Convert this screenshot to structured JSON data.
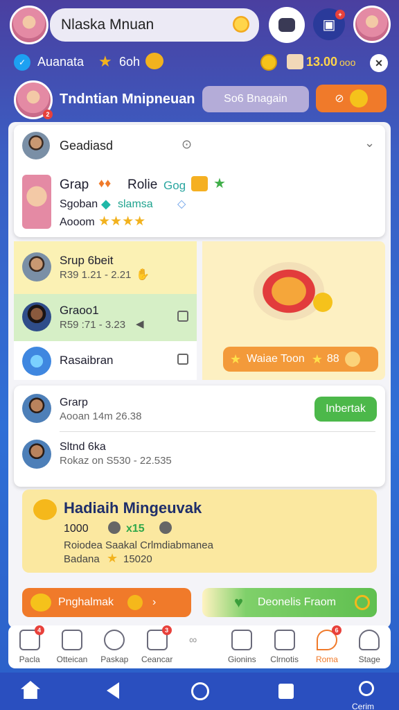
{
  "header": {
    "name_field": "Nlaska Mnuan",
    "sub_left": "Auanata",
    "sub_mid": "6oh",
    "coins": "13.00",
    "coins_suffix": "ooo"
  },
  "group_bar": {
    "title": "Tndntian Mnipneuan",
    "button": "So6 Bnagain"
  },
  "top_card": {
    "name": "Geadiasd",
    "line1": "Grap",
    "line1b": "Rolie",
    "line1c": "Gog",
    "line2": "Sgoban",
    "line2b": "slamsa",
    "line3": "Aooom"
  },
  "list_left": [
    {
      "title": "Srup 6beit",
      "sub": "R39 1.21 - 2.21"
    },
    {
      "title": "Graoo1",
      "sub": "R59 :71 - 3.23"
    },
    {
      "title": "Rasaibran",
      "sub": ""
    }
  ],
  "promo_right": {
    "button": "Waiae Toon",
    "count": "88"
  },
  "list2": [
    {
      "title": "Grarp",
      "sub": "Aooan 14m 26.38"
    },
    {
      "title": "Sltnd 6ka",
      "sub": "Rokaz on S530 - 22.535"
    }
  ],
  "invite_button": "Inbertak",
  "reward": {
    "title": "Hadiaih Mingeuvak",
    "line1": "1000",
    "line1b": "x15",
    "line2": "Roiodea Saakal Crlmdiabmanea",
    "line3": "Badana",
    "line3b": "15020"
  },
  "action_left": "Pnghalmak",
  "action_right": "Deonelis Fraom",
  "bottom_nav": [
    {
      "label": "Pacla"
    },
    {
      "label": "Otteican"
    },
    {
      "label": "Paskap"
    },
    {
      "label": "Ceancar"
    },
    {
      "label": ""
    },
    {
      "label": "Gionins"
    },
    {
      "label": "Clrnotis"
    },
    {
      "label": "Roma"
    },
    {
      "label": "Stage"
    }
  ],
  "system_nav": {
    "right_label": "Cerim"
  },
  "colors": {
    "accent_orange": "#f07a2a",
    "green": "#4cb84a",
    "purple": "#4a3fa0"
  }
}
